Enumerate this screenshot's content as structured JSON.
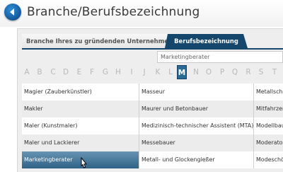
{
  "header": {
    "title": "Branche/Berufsbezeichnung",
    "back_icon": "arrow-left-icon"
  },
  "tabs": [
    {
      "label": "Branche Ihres zu gründenden Unternehmens",
      "active": false
    },
    {
      "label": "Berufsbezeichnung",
      "active": true
    }
  ],
  "search": {
    "value": "Marketingberater"
  },
  "alphabet": {
    "letters": [
      "A",
      "B",
      "C",
      "D",
      "E",
      "F",
      "G",
      "H",
      "I",
      "J",
      "K",
      "L",
      "M",
      "N",
      "O",
      "P",
      "Q",
      "R",
      "S",
      "T"
    ],
    "active": "M"
  },
  "table": {
    "rows": [
      [
        "Magier (Zauberkünstler)",
        "Masseur",
        "Metallschlei"
      ],
      [
        "Makler",
        "Maurer und Betonbauer",
        "Mitfahrzentr"
      ],
      [
        "Maler (Kunstmaler)",
        "Medizinisch-technischer Assistent (MTA)",
        "Modellbauer"
      ],
      [
        "Maler und Lackierer",
        "Messebauer",
        "Moderator"
      ],
      [
        "Marketingberater",
        "Metall- und Glockengießer",
        "Modeschöpf"
      ]
    ],
    "selected_row": 4
  },
  "colors": {
    "accent": "#15466c",
    "selected": "#2f6286",
    "active_letter": "#2b6a96"
  }
}
